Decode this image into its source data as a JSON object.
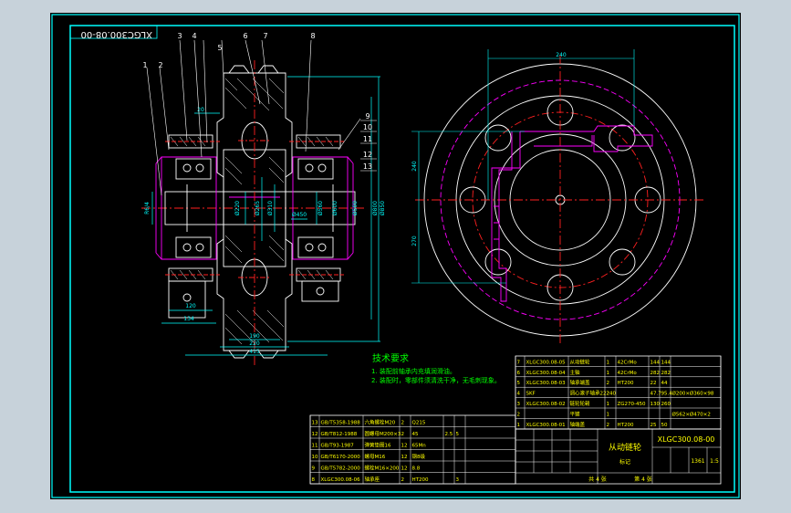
{
  "colors": {
    "viewport": "#c7d2da",
    "background": "#000000",
    "frame": "#00ffff",
    "outline": "#ffffff",
    "centerline": "#ff2020",
    "dimension": "#00ffff",
    "hatch": "#ffffff",
    "magenta": "#ff00ff",
    "notes": "#00ff00",
    "table_text": "#ffff00",
    "leader": "#ffffff"
  },
  "drawing_number_rotated": "XLGC300.08-00",
  "balloons": [
    "1",
    "2",
    "3",
    "4",
    "5",
    "6",
    "7",
    "8",
    "9",
    "10",
    "11",
    "12",
    "13"
  ],
  "dimensions": {
    "section": [
      "20",
      "Ø220",
      "Ø265",
      "Ø310",
      "120",
      "134",
      "190",
      "220",
      "415",
      "Ø850",
      "Ø800",
      "Ø560",
      "Ø600",
      "Ø500",
      "Ø450",
      "R6/4"
    ],
    "end_view": [
      "240",
      "240",
      "270"
    ]
  },
  "tech_notes": {
    "title": "技术要求",
    "lines": [
      "1. 装配前轴承内充填润滑油。",
      "2. 装配时，零部件须清洗干净，无毛刺现象。"
    ]
  },
  "parts_list_left": [
    {
      "no": "13",
      "code": "GB/T5358-1988",
      "name": "六角螺栓M20",
      "qty": "2",
      "mat": "Q215",
      "w1": "",
      "w2": ""
    },
    {
      "no": "12",
      "code": "GB/T812-1988",
      "name": "圆螺母M200×3",
      "qty": "2",
      "mat": "45",
      "w1": "2.5",
      "w2": "5"
    },
    {
      "no": "11",
      "code": "GB/T93-1987",
      "name": "弹簧垫圈16",
      "qty": "12",
      "mat": "65Mn",
      "w1": "",
      "w2": ""
    },
    {
      "no": "10",
      "code": "GB/T6170-2000",
      "name": "螺母M16",
      "qty": "12",
      "mat": "钢8级",
      "w1": "",
      "w2": ""
    },
    {
      "no": "9",
      "code": "GB/T5782-2000",
      "name": "螺栓M16×200",
      "qty": "12",
      "mat": "8.8",
      "w1": "",
      "w2": ""
    },
    {
      "no": "8",
      "code": "XLGC300.08-06",
      "name": "轴承座",
      "qty": "2",
      "mat": "HT200",
      "w1": "",
      "w2": "3"
    }
  ],
  "parts_list_right": [
    {
      "no": "7",
      "code": "XLGC300.08-05",
      "name": "从动链轮",
      "qty": "1",
      "mat": "42CrMo",
      "w1": "144",
      "w2": "144"
    },
    {
      "no": "6",
      "code": "XLGC300.08-04",
      "name": "主轴",
      "qty": "1",
      "mat": "42CrMo",
      "w1": "282",
      "w2": "282"
    },
    {
      "no": "5",
      "code": "XLGC300.08-03",
      "name": "轴承端盖",
      "qty": "2",
      "mat": "HT200",
      "w1": "22",
      "w2": "44"
    },
    {
      "no": "4",
      "code": "SKF",
      "name": "调心滚子轴承22240",
      "qty": "2",
      "mat": "",
      "w1": "47.7",
      "w2": "95.4",
      "note": "Ø200×Ø360×98"
    },
    {
      "no": "3",
      "code": "XLGC300.08-02",
      "name": "链轮轮毂",
      "qty": "1",
      "mat": "ZG270-450",
      "w1": "130",
      "w2": "260"
    },
    {
      "no": "2",
      "code": "",
      "name": "平键",
      "qty": "1",
      "mat": "",
      "w1": "",
      "w2": "",
      "note": "Ø562×Ø470×2"
    },
    {
      "no": "1",
      "code": "XLGC300.08-01",
      "name": "轴端盖",
      "qty": "2",
      "mat": "HT200",
      "w1": "25",
      "w2": "50"
    }
  ],
  "title_block": {
    "drawing_title": "从动链轮",
    "drawing_code": "XLGC300.08-00",
    "scale": "1:5",
    "sheet": "共 4 张",
    "sheet_of": "第 4 张",
    "weight": "1361",
    "design_label": "标记"
  }
}
